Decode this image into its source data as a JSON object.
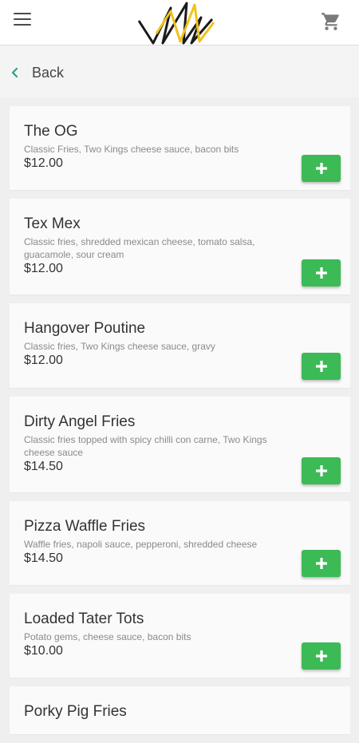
{
  "header": {
    "menu_icon": "hamburger-menu-icon",
    "logo_icon": "crown-logo-icon",
    "cart_icon": "shopping-cart-icon"
  },
  "nav": {
    "back_label": "Back",
    "accent": "#2e9e8a"
  },
  "colors": {
    "add_button": "#3cba55"
  },
  "menu_items": [
    {
      "title": "The OG",
      "description": "Classic Fries, Two Kings cheese sauce, bacon bits",
      "price": "$12.00"
    },
    {
      "title": "Tex Mex",
      "description": "Classic fries, shredded mexican cheese, tomato salsa, guacamole, sour cream",
      "price": "$12.00"
    },
    {
      "title": "Hangover Poutine",
      "description": "Classic fries, Two Kings cheese sauce, gravy",
      "price": "$12.00"
    },
    {
      "title": "Dirty Angel Fries",
      "description": "Classic fries topped with spicy chilli con carne, Two Kings cheese sauce",
      "price": "$14.50"
    },
    {
      "title": "Pizza Waffle Fries",
      "description": "Waffle fries, napoli sauce, pepperoni, shredded cheese",
      "price": "$14.50"
    },
    {
      "title": "Loaded Tater Tots",
      "description": "Potato gems, cheese sauce, bacon bits",
      "price": "$10.00"
    },
    {
      "title": "Porky Pig Fries",
      "description": "",
      "price": ""
    }
  ]
}
